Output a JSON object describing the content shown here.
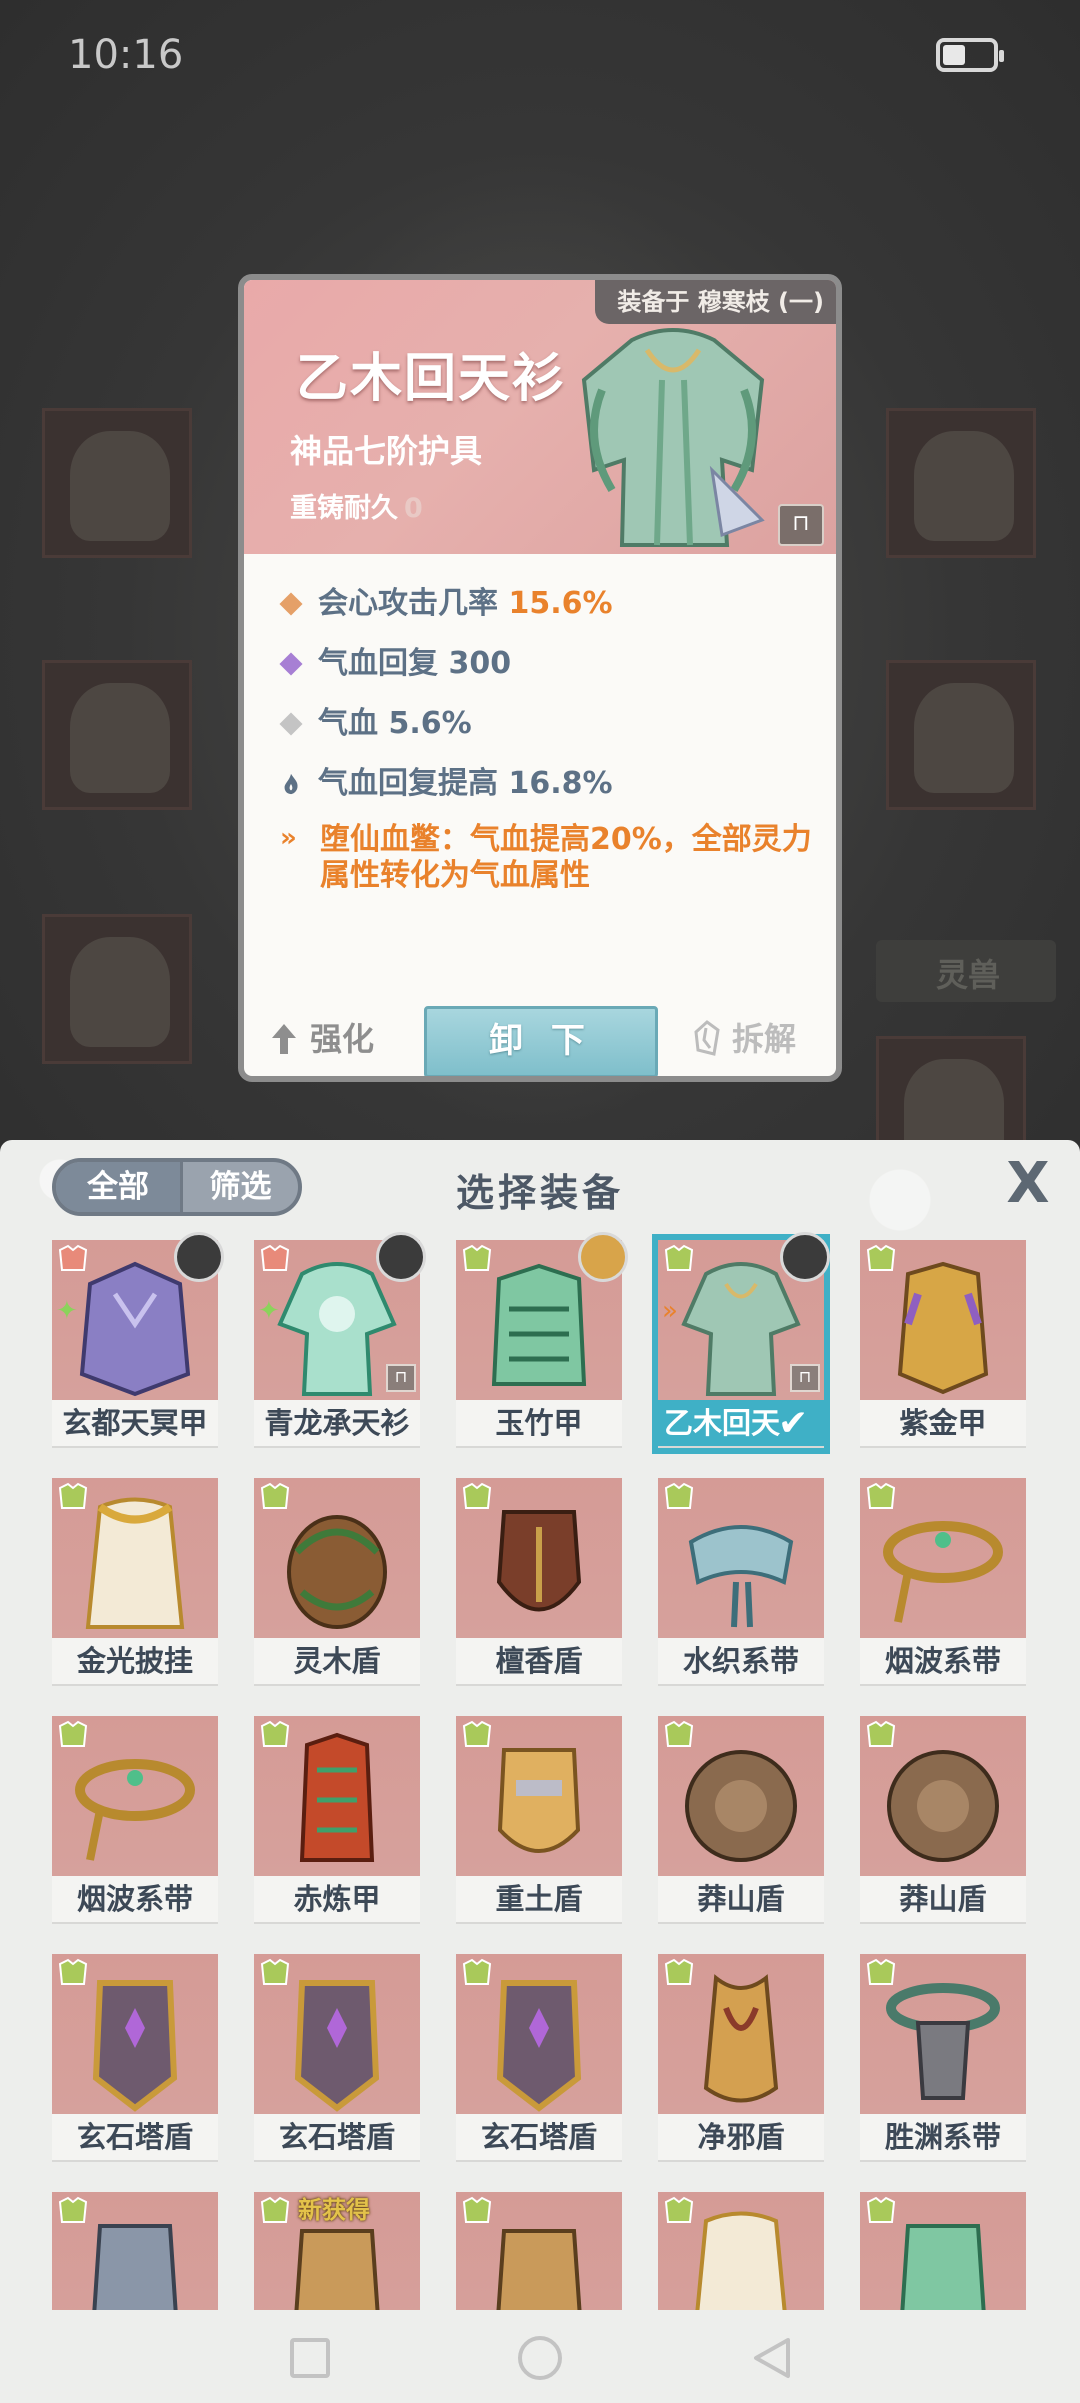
{
  "status_bar": {
    "time": "10:16"
  },
  "background": {
    "pet_tab_label": "灵兽"
  },
  "detail": {
    "equipped_by": "装备于 穆寒枝 (一)",
    "name": "乙木回天衫",
    "grade": "神品七阶护具",
    "durability_label": "重铸耐久",
    "durability_value": "0",
    "stats": [
      {
        "label": "会心攻击几率",
        "value": "15.6%",
        "icon": "diamond-orange-icon",
        "color": "#e5a068"
      },
      {
        "label": "气血回复",
        "value": "300",
        "icon": "diamond-purple-icon",
        "color": "#a77fd4"
      },
      {
        "label": "气血",
        "value": "5.6%",
        "icon": "diamond-gray-icon",
        "color": "#c4c4c4"
      },
      {
        "label": "气血回复提高",
        "value": "16.8%",
        "icon": "flame-icon",
        "color": "#5d7186"
      }
    ],
    "special": "堕仙血鳖：气血提高20%，全部灵力属性转化为气血属性",
    "enhance_label": "强化",
    "unequip_label": "卸 下",
    "dismantle_label": "拆解"
  },
  "sheet": {
    "tab_all": "全部",
    "tab_filter": "筛选",
    "title": "选择装备",
    "close": "X",
    "items": [
      {
        "name": "玄都天冥甲"
      },
      {
        "name": "青龙承天衫"
      },
      {
        "name": "玉竹甲"
      },
      {
        "name": "乙木回天衫"
      },
      {
        "name": "紫金甲"
      },
      {
        "name": "金光披挂"
      },
      {
        "name": "灵木盾"
      },
      {
        "name": "檀香盾"
      },
      {
        "name": "水织系带"
      },
      {
        "name": "烟波系带"
      },
      {
        "name": "烟波系带"
      },
      {
        "name": "赤炼甲"
      },
      {
        "name": "重土盾"
      },
      {
        "name": "莽山盾"
      },
      {
        "name": "莽山盾"
      },
      {
        "name": "玄石塔盾"
      },
      {
        "name": "玄石塔盾"
      },
      {
        "name": "玄石塔盾"
      },
      {
        "name": "净邪盾"
      },
      {
        "name": "胜渊系带"
      }
    ],
    "new_tag": "新获得",
    "selected_index": 3,
    "selected_label": "乙木回天"
  },
  "colors": {
    "accent": "#3fb0c6",
    "highlight": "#e9822c",
    "tile_bg": "#d59b96"
  }
}
